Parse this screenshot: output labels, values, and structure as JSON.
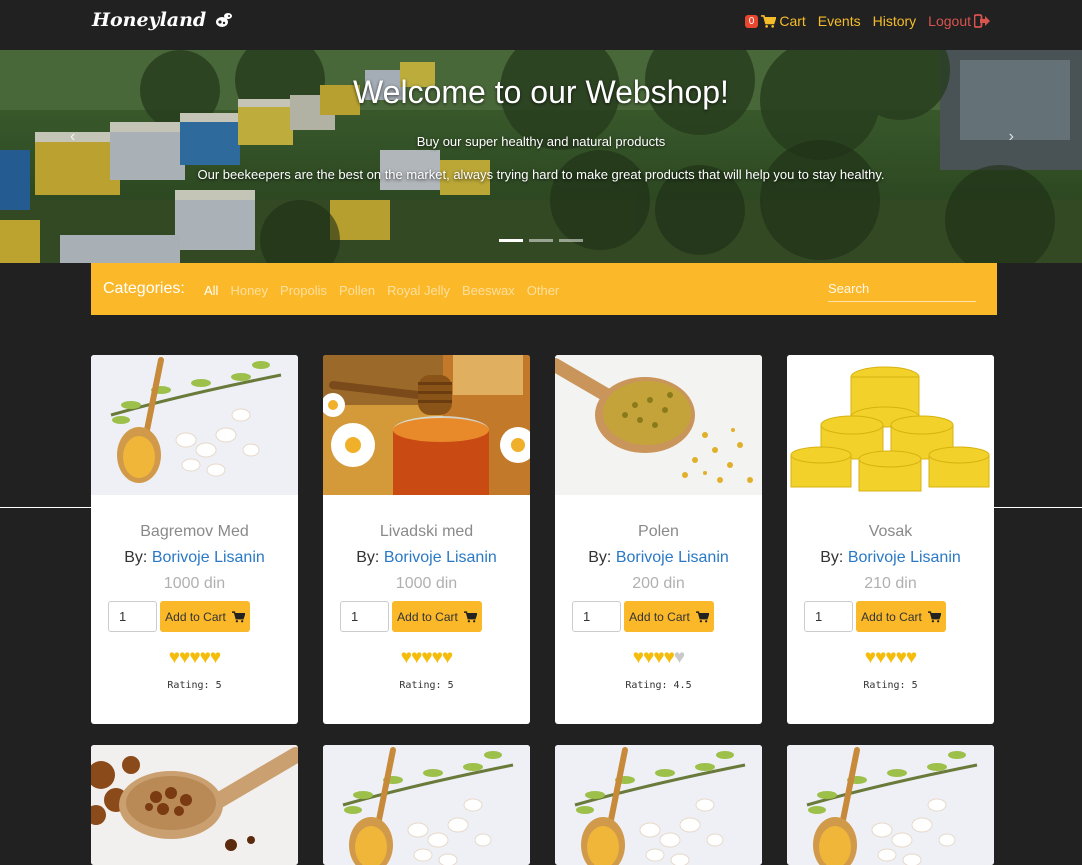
{
  "nav": {
    "brand": "Honeyland",
    "cart_count": "0",
    "cart_label": "Cart",
    "events_label": "Events",
    "history_label": "History",
    "logout_label": "Logout"
  },
  "carousel": {
    "title": "Welcome to our Webshop!",
    "subtitle": "Buy our super healthy and natural products",
    "description": "Our beekeepers are the best on the market, always trying hard to make great products that will help you to stay healthy.",
    "prev_icon": "‹",
    "next_icon": "›",
    "slides": 3,
    "active_slide": 1
  },
  "categories": {
    "label": "Categories:",
    "items": [
      "All",
      "Honey",
      "Propolis",
      "Pollen",
      "Royal Jelly",
      "Beeswax",
      "Other"
    ],
    "active": "All",
    "search_placeholder": "Search"
  },
  "products": [
    {
      "name": "Bagremov Med",
      "by_prefix": "By:",
      "seller": "Borivoje Lisanin",
      "price": "1000 din",
      "qty": "1",
      "add_label": "Add to Cart",
      "rating_text": "Rating: 5",
      "rating": 5,
      "image": "acacia-honey-spoon"
    },
    {
      "name": "Livadski med",
      "by_prefix": "By:",
      "seller": "Borivoje Lisanin",
      "price": "1000 din",
      "qty": "1",
      "add_label": "Add to Cart",
      "rating_text": "Rating: 5",
      "rating": 5,
      "image": "honey-jar-daisies"
    },
    {
      "name": "Polen",
      "by_prefix": "By:",
      "seller": "Borivoje Lisanin",
      "price": "200 din",
      "qty": "1",
      "add_label": "Add to Cart",
      "rating_text": "Rating: 4.5",
      "rating": 4.5,
      "image": "pollen-spoon"
    },
    {
      "name": "Vosak",
      "by_prefix": "By:",
      "seller": "Borivoje Lisanin",
      "price": "210 din",
      "qty": "1",
      "add_label": "Add to Cart",
      "rating_text": "Rating: 5",
      "rating": 5,
      "image": "beeswax-blocks"
    },
    {
      "image": "propolis-spoon"
    },
    {
      "image": "acacia-honey-spoon"
    },
    {
      "image": "acacia-honey-spoon"
    },
    {
      "image": "acacia-honey-spoon"
    }
  ],
  "colors": {
    "background": "#212121",
    "accent": "#fbb829",
    "link": "#2a79c6",
    "logout": "#d9534f",
    "badge": "#e8472f"
  }
}
